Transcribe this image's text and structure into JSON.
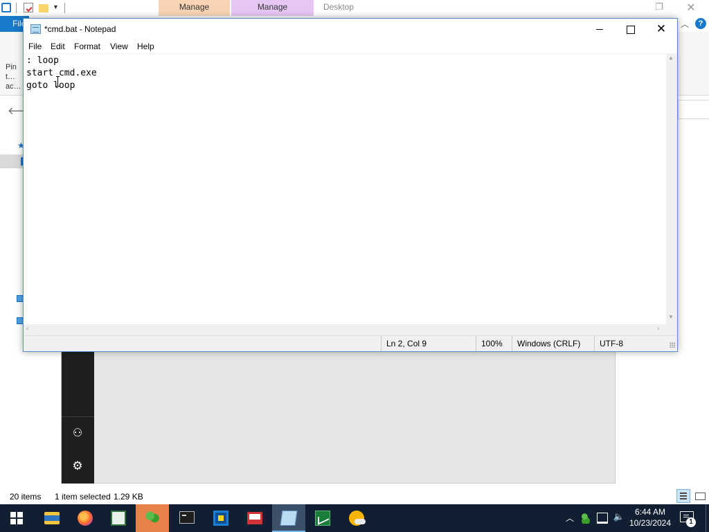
{
  "explorer": {
    "context_tabs": [
      "Manage",
      "Manage",
      "Desktop"
    ],
    "file_tab": "File",
    "ribbon_pin_label": "Pin t… ac…",
    "help_label": "?",
    "status": {
      "item_count": "20 items",
      "selected": "1 item selected",
      "size": "1.29 KB"
    }
  },
  "notepad": {
    "title": "*cmd.bat - Notepad",
    "menu": [
      "File",
      "Edit",
      "Format",
      "View",
      "Help"
    ],
    "content": ": loop\nstart cmd.exe\ngoto loop",
    "status": {
      "position": "Ln 2, Col 9",
      "zoom": "100%",
      "line_endings": "Windows (CRLF)",
      "encoding": "UTF-8"
    }
  },
  "taskbar": {
    "apps": [
      "start-icon",
      "file-explorer-icon",
      "firefox-icon",
      "notepad-plus-icon",
      "users-icon",
      "cmd-icon",
      "virtualbox-icon",
      "presentation-icon",
      "notepad-icon",
      "chart-icon",
      "weather-icon"
    ],
    "active_app": "notepad-icon",
    "clock_time": "6:44 AM",
    "clock_date": "10/23/2024",
    "notification_count": "1"
  },
  "colors": {
    "accent": "#1979ca",
    "taskbar": "#101f31",
    "manage_tab_1": "#f8d3b4",
    "manage_tab_2": "#e6c6f2"
  }
}
